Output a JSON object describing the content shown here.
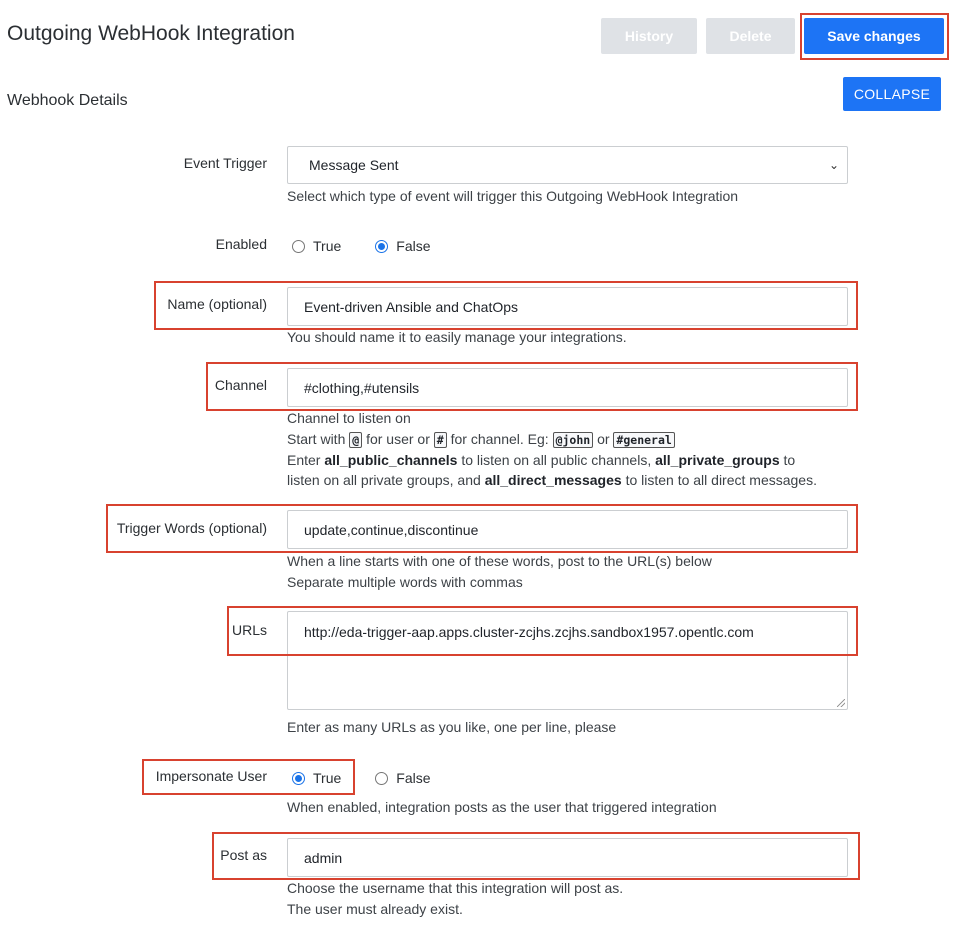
{
  "header": {
    "title": "Outgoing WebHook Integration",
    "history_label": "History",
    "delete_label": "Delete",
    "save_label": "Save changes"
  },
  "section": {
    "title": "Webhook Details",
    "collapse_label": "COLLAPSE"
  },
  "event_trigger": {
    "label": "Event Trigger",
    "value": "Message Sent",
    "hint": "Select which type of event will trigger this Outgoing WebHook Integration"
  },
  "enabled": {
    "label": "Enabled",
    "options": [
      "True",
      "False"
    ],
    "selected": "False"
  },
  "name": {
    "label": "Name (optional)",
    "value": "Event-driven Ansible and ChatOps",
    "hint": "You should name it to easily manage your integrations."
  },
  "channel": {
    "label": "Channel",
    "value": "#clothing,#utensils",
    "hint1": "Channel to listen on",
    "hint2_a": "Start with",
    "code_at": "@",
    "hint2_b": "for user or",
    "code_hash": "#",
    "hint2_c": "for channel. Eg:",
    "code_john": "@john",
    "hint2_d": "or",
    "code_general": "#general",
    "hint3_a": "Enter",
    "hint3_b": "all_public_channels",
    "hint3_c": "to listen on all public channels,",
    "hint3_d": "all_private_groups",
    "hint3_e": "to",
    "hint4_a": "listen on all private groups, and",
    "hint4_b": "all_direct_messages",
    "hint4_c": "to listen to all direct messages."
  },
  "trigger_words": {
    "label": "Trigger Words (optional)",
    "value": "update,continue,discontinue",
    "hint1": "When a line starts with one of these words, post to the URL(s) below",
    "hint2": "Separate multiple words with commas"
  },
  "urls": {
    "label": "URLs",
    "value": "http://eda-trigger-aap.apps.cluster-zcjhs.zcjhs.sandbox1957.opentlc.com",
    "hint": "Enter as many URLs as you like, one per line, please"
  },
  "impersonate": {
    "label": "Impersonate User",
    "options": [
      "True",
      "False"
    ],
    "selected": "True",
    "hint": "When enabled, integration posts as the user that triggered integration"
  },
  "post_as": {
    "label": "Post as",
    "value": "admin",
    "hint1": "Choose the username that this integration will post as.",
    "hint2": "The user must already exist."
  },
  "colors": {
    "primary": "#1d74f5",
    "disabled": "#dfe2e6",
    "highlight": "#d8422f"
  }
}
